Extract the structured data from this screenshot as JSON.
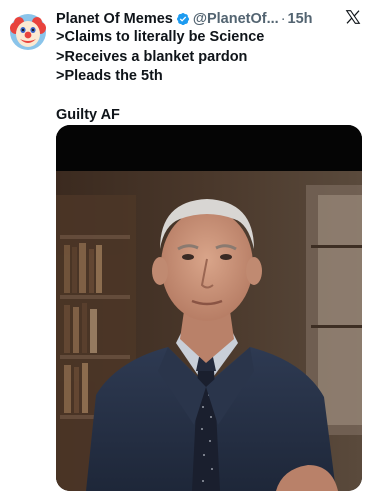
{
  "tweet": {
    "display_name": "Planet Of Memes",
    "handle": "@PlanetOf...",
    "separator": "·",
    "time": "15h",
    "lines": [
      ">Claims to literally be Science",
      ">Receives a blanket pardon",
      ">Pleads the 5th",
      "Guilty AF"
    ]
  },
  "icons": {
    "avatar": "clown-face-avatar",
    "verified": "verified-badge-icon",
    "platform": "x-logo-icon"
  },
  "colors": {
    "verified_blue": "#1d9bf0",
    "secondary_text": "#536471",
    "primary_text": "#0f1419"
  }
}
